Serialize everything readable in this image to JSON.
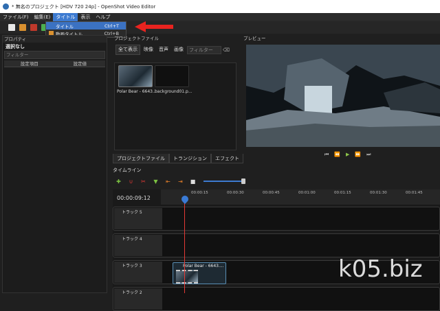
{
  "window": {
    "title": "* 無名のプロジェクト [HDV 720 24p] - OpenShot Video Editor"
  },
  "menubar": {
    "items": [
      "ファイル(F)",
      "編集(E)",
      "タイトル",
      "表示",
      "ヘルプ"
    ]
  },
  "title_menu": {
    "items": [
      {
        "label": "タイトル",
        "shortcut": "Ctrl+T"
      },
      {
        "label": "動画タイトル",
        "shortcut": "Ctrl+B"
      }
    ]
  },
  "properties": {
    "title": "プロパティ",
    "selection": "選択なし",
    "filter_placeholder": "フィルター",
    "col_name": "設定項目",
    "col_value": "設定値"
  },
  "project_files": {
    "title": "プロジェクトファイル",
    "tabs": [
      "全て表示",
      "映像",
      "音声",
      "画像"
    ],
    "filter_placeholder": "フィルター",
    "files": [
      "Polar Bear - 6643...",
      "background01.p..."
    ]
  },
  "preview": {
    "title": "プレビュー"
  },
  "bottom_tabs": [
    "プロジェクトファイル",
    "トランジション",
    "エフェクト"
  ],
  "timeline": {
    "title": "タイムライン",
    "current_time": "00:00:09:12",
    "ticks": [
      "00:00:15",
      "00:00:30",
      "00:00:45",
      "00:01:00",
      "00:01:15",
      "00:01:30",
      "00:01:45"
    ],
    "tracks": [
      "トラック 5",
      "トラック 4",
      "トラック 3",
      "トラック 2"
    ],
    "clip_label": "Polar Bear - 6643...."
  },
  "watermark": "k05.biz",
  "colors": {
    "accent": "#3d7bd1",
    "playhead": "#e53935",
    "arrow": "#e8231f"
  }
}
